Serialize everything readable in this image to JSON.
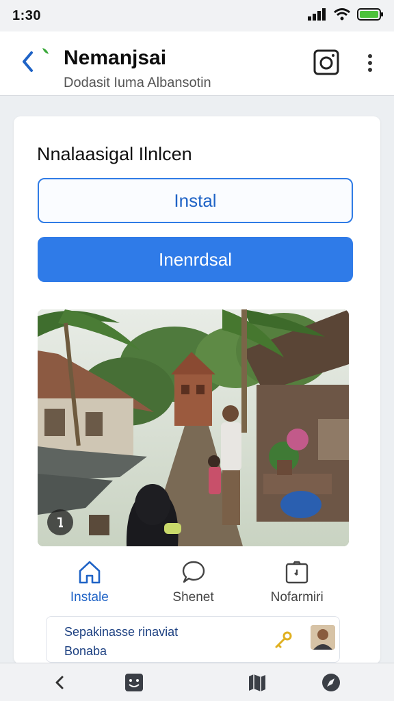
{
  "status_bar": {
    "time": "1:30"
  },
  "header": {
    "title": "Nemanjsai",
    "subtitle": "Dodasit Iuma Albansotin",
    "icons": {
      "back": "chevron-left-icon",
      "camera": "camera-icon",
      "more": "more-vertical-icon"
    }
  },
  "card": {
    "title": "Nnalaasigal Ilnlcen",
    "install_label": "Instal",
    "primary_label": "Inenrdsal",
    "photo": {
      "badge_icon": "info-icon"
    }
  },
  "tabs": [
    {
      "label": "Instale",
      "icon": "home-icon",
      "active": true
    },
    {
      "label": "Shenet",
      "icon": "chat-icon",
      "active": false
    },
    {
      "label": "Nofarmiri",
      "icon": "camera-frame-icon",
      "active": false
    }
  ],
  "promo": {
    "line1": "Sepakinasse rinaviat",
    "line2": "Bonaba",
    "key_icon": "key-icon",
    "avatar": "avatar"
  },
  "bottom_nav": [
    {
      "icon": "back-arrow-icon"
    },
    {
      "icon": "smile-icon"
    },
    {
      "icon": "map-icon"
    },
    {
      "icon": "compass-icon"
    }
  ],
  "colors": {
    "accent": "#2f7be8",
    "accent_text": "#1f63c6",
    "key_gold": "#e0b020"
  }
}
